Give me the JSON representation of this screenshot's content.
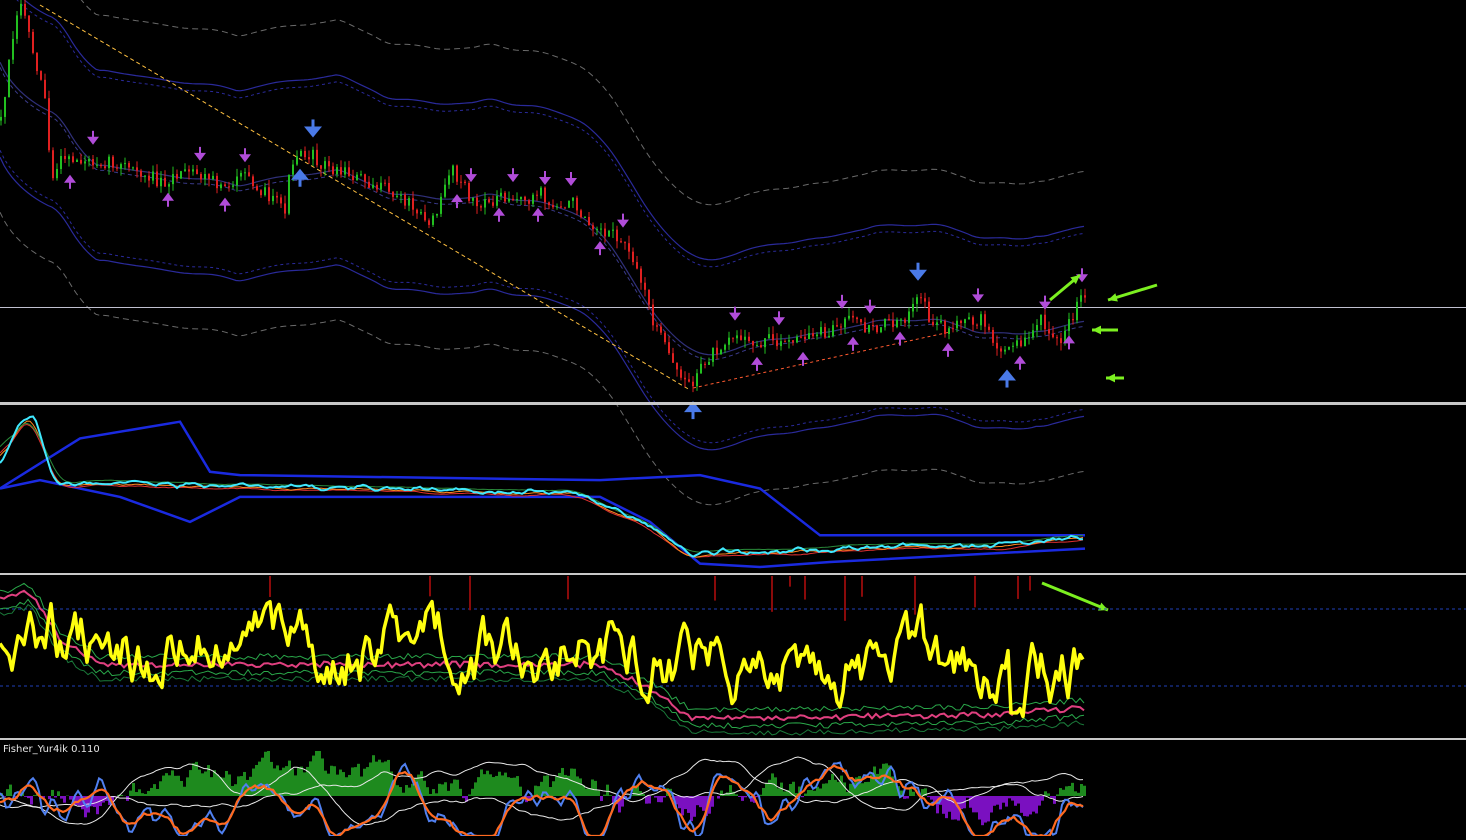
{
  "colors": {
    "background": "#000000",
    "separator": "#c8c8c8",
    "grid_level": "#1f3fb8",
    "bull_candle": "#22c020",
    "bear_candle": "#e02020",
    "small_arrow": "#b04cd8",
    "big_arrow": "#4a7ae8",
    "annotation_arrow": "#7cf020",
    "trendline_main": "#ffc040",
    "trendline_low": "#ff5a30",
    "envelope_inner": "#2a2a9a",
    "envelope_outer": "#6a6a6a",
    "osc_band": "#1a2ae0",
    "osc_main": "#40e8ff",
    "osc_ma_orange": "#ff8a20",
    "osc_ma_red": "#e03030",
    "yellow_line": "#ffff10",
    "hist_green": "#1e8a1e",
    "hist_purple": "#7a10c0",
    "fisher_blue": "#5080f0",
    "fisher_orange": "#ff6a20",
    "fisher_white": "#e8e8e8"
  },
  "indicator_labels": {
    "fisher": "Fisher_Yur4ik 0.110"
  },
  "chart_data": [
    {
      "type": "candlestick",
      "pane": "price",
      "price_path": [
        [
          0,
          0.3
        ],
        [
          0.012,
          0.08
        ],
        [
          0.02,
          0.0
        ],
        [
          0.03,
          0.1
        ],
        [
          0.045,
          0.25
        ],
        [
          0.05,
          0.45
        ],
        [
          0.06,
          0.4
        ],
        [
          0.08,
          0.4
        ],
        [
          0.1,
          0.4
        ],
        [
          0.13,
          0.42
        ],
        [
          0.16,
          0.45
        ],
        [
          0.19,
          0.43
        ],
        [
          0.22,
          0.46
        ],
        [
          0.25,
          0.44
        ],
        [
          0.27,
          0.5
        ],
        [
          0.285,
          0.52
        ],
        [
          0.29,
          0.4
        ],
        [
          0.3,
          0.37
        ],
        [
          0.33,
          0.42
        ],
        [
          0.36,
          0.44
        ],
        [
          0.39,
          0.48
        ],
        [
          0.42,
          0.52
        ],
        [
          0.43,
          0.57
        ],
        [
          0.44,
          0.48
        ],
        [
          0.45,
          0.42
        ],
        [
          0.46,
          0.46
        ],
        [
          0.48,
          0.52
        ],
        [
          0.5,
          0.48
        ],
        [
          0.52,
          0.5
        ],
        [
          0.54,
          0.48
        ],
        [
          0.55,
          0.52
        ],
        [
          0.57,
          0.5
        ],
        [
          0.59,
          0.55
        ],
        [
          0.61,
          0.58
        ],
        [
          0.63,
          0.62
        ],
        [
          0.65,
          0.78
        ],
        [
          0.67,
          0.9
        ],
        [
          0.69,
          0.96
        ],
        [
          0.71,
          0.88
        ],
        [
          0.73,
          0.83
        ],
        [
          0.75,
          0.86
        ],
        [
          0.77,
          0.84
        ],
        [
          0.79,
          0.86
        ],
        [
          0.81,
          0.83
        ],
        [
          0.83,
          0.82
        ],
        [
          0.85,
          0.8
        ],
        [
          0.87,
          0.82
        ],
        [
          0.89,
          0.8
        ],
        [
          0.91,
          0.78
        ],
        [
          0.92,
          0.74
        ],
        [
          0.93,
          0.8
        ],
        [
          0.95,
          0.82
        ],
        [
          0.97,
          0.8
        ],
        [
          0.98,
          0.79
        ],
        [
          0.995,
          0.86
        ],
        [
          1.0,
          0.88
        ],
        [
          1.02,
          0.85
        ],
        [
          1.04,
          0.8
        ],
        [
          1.06,
          0.84
        ],
        [
          1.08,
          0.75
        ],
        [
          1.085,
          0.73
        ]
      ],
      "up_arrows": [
        70,
        168,
        225,
        457,
        499,
        538,
        600,
        757,
        803,
        853,
        900,
        948,
        1020,
        1069
      ],
      "down_arrows": [
        93,
        200,
        245,
        471,
        513,
        545,
        571,
        623,
        735,
        779,
        842,
        870,
        978,
        1045,
        1082
      ],
      "big_up_arrows": [
        300,
        693,
        1007
      ],
      "big_down_arrows": [
        313,
        918
      ],
      "horizontal_level": 0.765,
      "annotation_arrows": 4
    },
    {
      "type": "line",
      "pane": "oscillator",
      "series_count": 6
    },
    {
      "type": "line",
      "pane": "yellow-oscillator",
      "levels": 2
    },
    {
      "type": "histogram",
      "pane": "fisher",
      "series_count": 4
    }
  ]
}
